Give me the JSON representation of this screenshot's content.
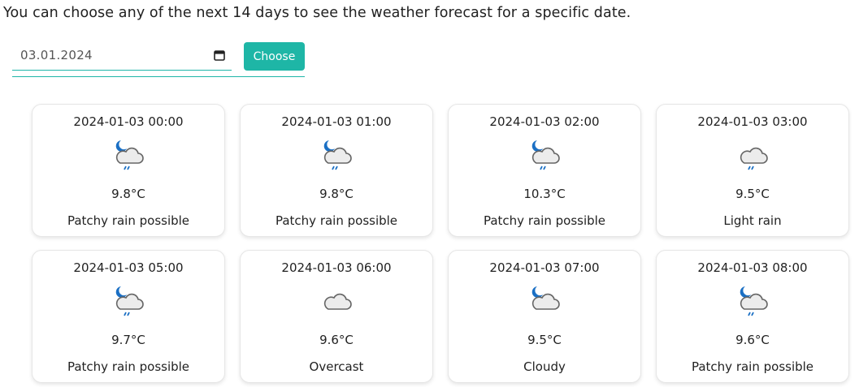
{
  "intro": "You can choose any of the next 14 days to see the weather forecast for a specific date.",
  "date_picker": {
    "value": "03.01.2024",
    "button_label": "Choose"
  },
  "colors": {
    "accent": "#1eb6a6"
  },
  "forecast": [
    {
      "time": "2024-01-03 00:00",
      "temp": "9.8°C",
      "condition": "Patchy rain possible",
      "icon": "moon-cloud-rain-icon"
    },
    {
      "time": "2024-01-03 01:00",
      "temp": "9.8°C",
      "condition": "Patchy rain possible",
      "icon": "moon-cloud-rain-icon"
    },
    {
      "time": "2024-01-03 02:00",
      "temp": "10.3°C",
      "condition": "Patchy rain possible",
      "icon": "moon-cloud-rain-icon"
    },
    {
      "time": "2024-01-03 03:00",
      "temp": "9.5°C",
      "condition": "Light rain",
      "icon": "cloud-rain-icon"
    },
    {
      "time": "2024-01-03 05:00",
      "temp": "9.7°C",
      "condition": "Patchy rain possible",
      "icon": "moon-cloud-rain-icon"
    },
    {
      "time": "2024-01-03 06:00",
      "temp": "9.6°C",
      "condition": "Overcast",
      "icon": "cloud-icon"
    },
    {
      "time": "2024-01-03 07:00",
      "temp": "9.5°C",
      "condition": "Cloudy",
      "icon": "moon-cloud-icon"
    },
    {
      "time": "2024-01-03 08:00",
      "temp": "9.6°C",
      "condition": "Patchy rain possible",
      "icon": "moon-cloud-rain-icon"
    }
  ]
}
